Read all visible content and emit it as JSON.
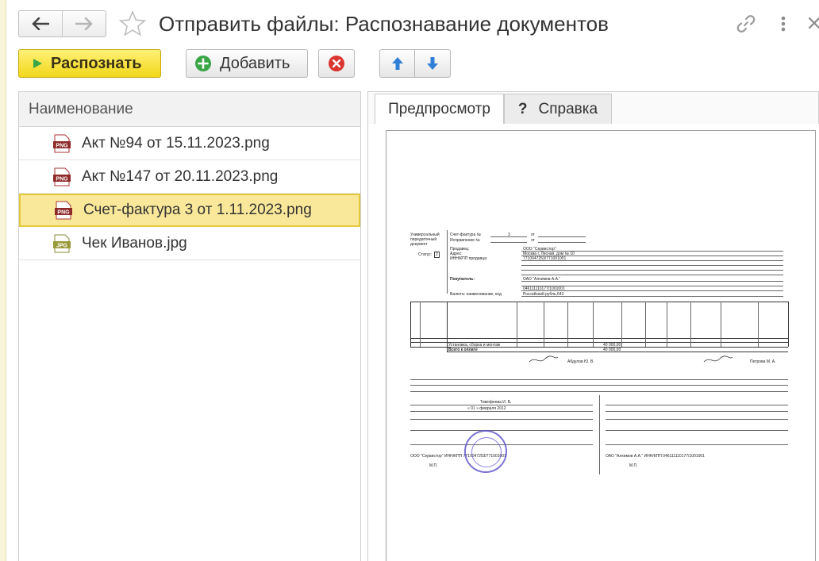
{
  "window": {
    "title": "Отправить файлы: Распознавание документов",
    "nav": {
      "back_icon": "arrow-left-icon",
      "forward_icon": "arrow-right-icon"
    },
    "header_icons": [
      "star-icon",
      "link-icon",
      "more-vertical-icon",
      "close-icon"
    ]
  },
  "toolbar": {
    "recognize_label": "Распознать",
    "add_label": "Добавить",
    "delete_icon": "delete-icon",
    "up_icon": "arrow-up-icon",
    "down_icon": "arrow-down-icon"
  },
  "file_list": {
    "header": "Наименование",
    "items": [
      {
        "name": "Акт №94 от 15.11.2023.png",
        "type": "PNG",
        "selected": false
      },
      {
        "name": "Акт №147 от 20.11.2023.png",
        "type": "PNG",
        "selected": false
      },
      {
        "name": "Счет-фактура 3 от 1.11.2023.png",
        "type": "PNG",
        "selected": true
      },
      {
        "name": "Чек Иванов.jpg",
        "type": "JPG",
        "selected": false
      }
    ]
  },
  "tabs": {
    "preview_label": "Предпросмотр",
    "help_label": "Справка",
    "help_icon": "?"
  },
  "doc": {
    "heading": "Универсальный передаточный документ",
    "invoice_label": "Счет-фактура №",
    "invoice_number": "3",
    "correction_label": "Исправление №",
    "date_from": "от",
    "status_label": "Статус:",
    "status_value": "2",
    "seller_label": "Продавец:",
    "seller_value": "ООО \"Сервистор\"",
    "address_label": "Адрес:",
    "address_value": "Москва г, Лесная, дом № 10",
    "inn_label": "ИНН/КПП продавца:",
    "inn_value": "7710047253/771001001",
    "buyer_label": "Покупатель:",
    "buyer_value": "ОАО \"Алхимов А.А.\"",
    "buyer_inn_value": "046111110177/1001001",
    "currency_label": "Валюта: наименование, код",
    "currency_value": "Российский рубль,643",
    "row_item": "Установка, сборка и монтаж",
    "row_sum": "40 000,00",
    "total_label": "Всего к оплате",
    "total_sum": "40 000,00",
    "signer_1": "Абдулов Ю. В.",
    "signer_2": "Петрова М. А.",
    "transfer_signer": "Тимофеева И. В.",
    "ship_date": "« 01 » февраля 2012",
    "seller_org": "ООО \"Сервистор\" ИНН/КПП 7710047253/771001001",
    "buyer_org": "ОАО \"Алхимов А.А.\" ИНН/КПП 046111110177/1001001",
    "mp": "М.П."
  },
  "colors": {
    "accent_yellow": "#f2d71a",
    "selection": "#f9e89a",
    "delete_red": "#d9362f",
    "arrow_blue": "#2f7fd6",
    "add_green": "#3aa648",
    "stamp_blue": "#5a4fc9"
  }
}
